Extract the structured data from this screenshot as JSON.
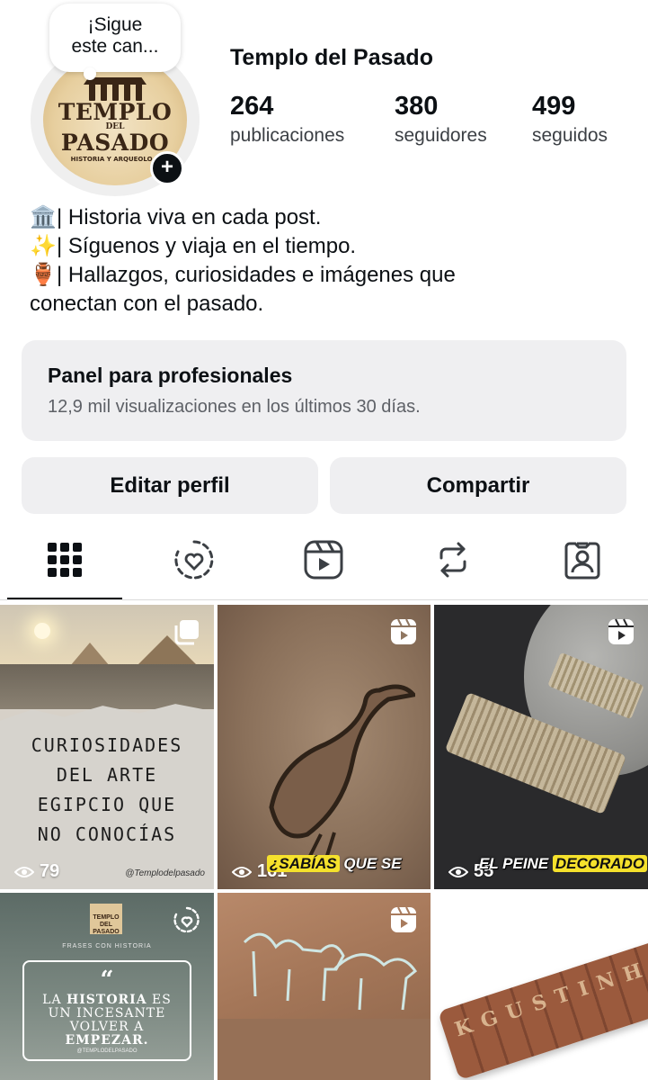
{
  "note": {
    "text_line1": "¡Sigue",
    "text_line2": "este can..."
  },
  "profile": {
    "username": "Templo del Pasado",
    "avatar_logo": {
      "line1": "TEMPLO",
      "line2": "DEL",
      "line3": "PASADO",
      "line4": "HISTORIA Y ARQUEOLO..."
    }
  },
  "stats": [
    {
      "value": "264",
      "label": "publicaciones"
    },
    {
      "value": "380",
      "label": "seguidores"
    },
    {
      "value": "499",
      "label": "seguidos"
    }
  ],
  "bio": {
    "lines": [
      {
        "emoji": "🏛️",
        "text": "| Historia viva en cada post."
      },
      {
        "emoji": "✨",
        "text": "| Síguenos y viaja en el tiempo."
      },
      {
        "emoji": "🏺",
        "text": "| Hallazgos, curiosidades e imágenes que"
      },
      {
        "emoji": "",
        "text": "conectan con el pasado."
      }
    ]
  },
  "professional_panel": {
    "title": "Panel para profesionales",
    "subtitle": "12,9 mil visualizaciones en los últimos 30 días."
  },
  "buttons": {
    "edit": "Editar perfil",
    "share": "Compartir"
  },
  "tabs": [
    {
      "icon": "grid-icon",
      "active": true
    },
    {
      "icon": "highlights-icon",
      "active": false
    },
    {
      "icon": "reels-icon",
      "active": false
    },
    {
      "icon": "reposts-icon",
      "active": false
    },
    {
      "icon": "tagged-icon",
      "active": false
    }
  ],
  "posts": [
    {
      "type": "carousel",
      "views": "79",
      "overlay_text": [
        "CURIOSIDADES",
        "DEL ARTE",
        "EGIPCIO QUE",
        "NO CONOCÍAS"
      ],
      "handle": "@Templodelpasado"
    },
    {
      "type": "reel",
      "views": "161",
      "caption_highlight": "¿SABÍAS",
      "caption_rest": "QUE SE"
    },
    {
      "type": "reel",
      "views": "55",
      "caption_plain": "EL PEINE",
      "caption_highlight": "DECORADO"
    },
    {
      "type": "post",
      "logo_text": "TEMPLO DEL PASADO",
      "tagline": "FRASES CON HISTORIA",
      "quote_mark": "“",
      "quote_line1_pre": "LA ",
      "quote_line1_bold": "HISTORIA",
      "quote_line1_post": " ES",
      "quote_line2": "UN INCESANTE",
      "quote_line3": "VOLVER A",
      "quote_line4": "EMPEZAR.",
      "handle": "@TEMPLODELPASADO"
    },
    {
      "type": "reel"
    },
    {
      "type": "post",
      "letters": "KGUSTINH"
    }
  ]
}
